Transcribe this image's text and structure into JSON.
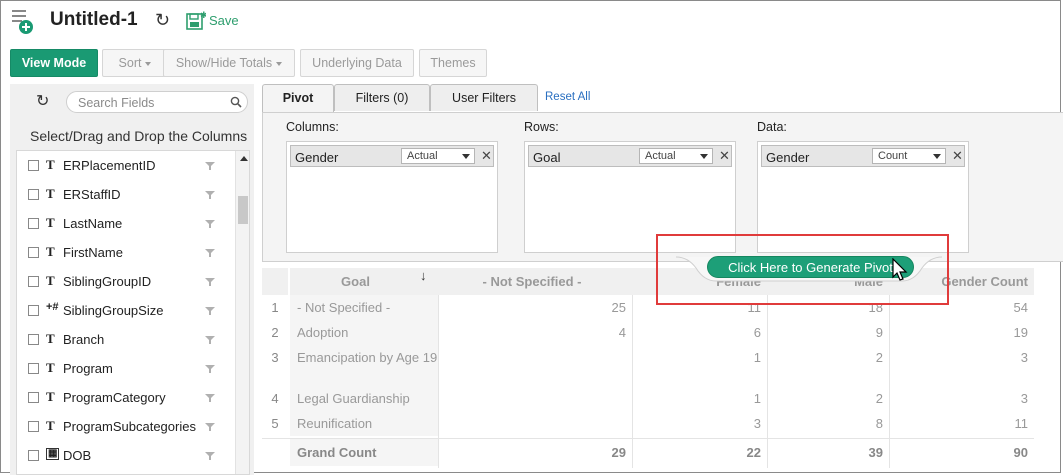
{
  "header": {
    "title": "Untitled-1",
    "save_label": "Save"
  },
  "toolbar": {
    "view_mode": "View Mode",
    "sort": "Sort",
    "show_hide_totals": "Show/Hide Totals",
    "underlying_data": "Underlying Data",
    "themes": "Themes"
  },
  "sidebar": {
    "search_placeholder": "Search Fields",
    "heading": "Select/Drag and Drop the Columns",
    "fields": [
      {
        "type": "T",
        "name": "ERPlacementID"
      },
      {
        "type": "T",
        "name": "ERStaffID"
      },
      {
        "type": "T",
        "name": "LastName"
      },
      {
        "type": "T",
        "name": "FirstName"
      },
      {
        "type": "T",
        "name": "SiblingGroupID"
      },
      {
        "type": "+#",
        "name": "SiblingGroupSize"
      },
      {
        "type": "T",
        "name": "Branch"
      },
      {
        "type": "T",
        "name": "Program"
      },
      {
        "type": "T",
        "name": "ProgramCategory"
      },
      {
        "type": "T",
        "name": "ProgramSubcategories"
      },
      {
        "type": "date",
        "name": "DOB"
      }
    ]
  },
  "tabs": {
    "pivot": "Pivot",
    "filters": "Filters (0)",
    "user_filters": "User Filters",
    "reset_all": "Reset All"
  },
  "config": {
    "columns": {
      "label": "Columns:",
      "field": "Gender",
      "agg": "Actual"
    },
    "rows": {
      "label": "Rows:",
      "field": "Goal",
      "agg": "Actual"
    },
    "data": {
      "label": "Data:",
      "field": "Gender",
      "agg": "Count"
    }
  },
  "generate_button": "Click Here to Generate Pivot",
  "pivot": {
    "headers": [
      "Goal",
      "- Not Specified -",
      "Female",
      "Male",
      "Gender Count"
    ],
    "rows": [
      {
        "num": "1",
        "goal": "- Not Specified -",
        "vals": [
          "25",
          "11",
          "18",
          "54"
        ]
      },
      {
        "num": "2",
        "goal": "Adoption",
        "vals": [
          "4",
          "6",
          "9",
          "19"
        ]
      },
      {
        "num": "3",
        "goal": "Emancipation by Age 19",
        "vals": [
          "",
          "1",
          "2",
          "3"
        ]
      },
      {
        "num": "4",
        "goal": "Legal Guardianship",
        "vals": [
          "",
          "1",
          "2",
          "3"
        ]
      },
      {
        "num": "5",
        "goal": "Reunification",
        "vals": [
          "",
          "3",
          "8",
          "11"
        ]
      }
    ],
    "grand": {
      "label": "Grand Count",
      "vals": [
        "29",
        "22",
        "39",
        "90"
      ]
    }
  },
  "colors": {
    "accent": "#1a9a73",
    "highlight": "#e03b3b",
    "link": "#2a6fc0"
  }
}
